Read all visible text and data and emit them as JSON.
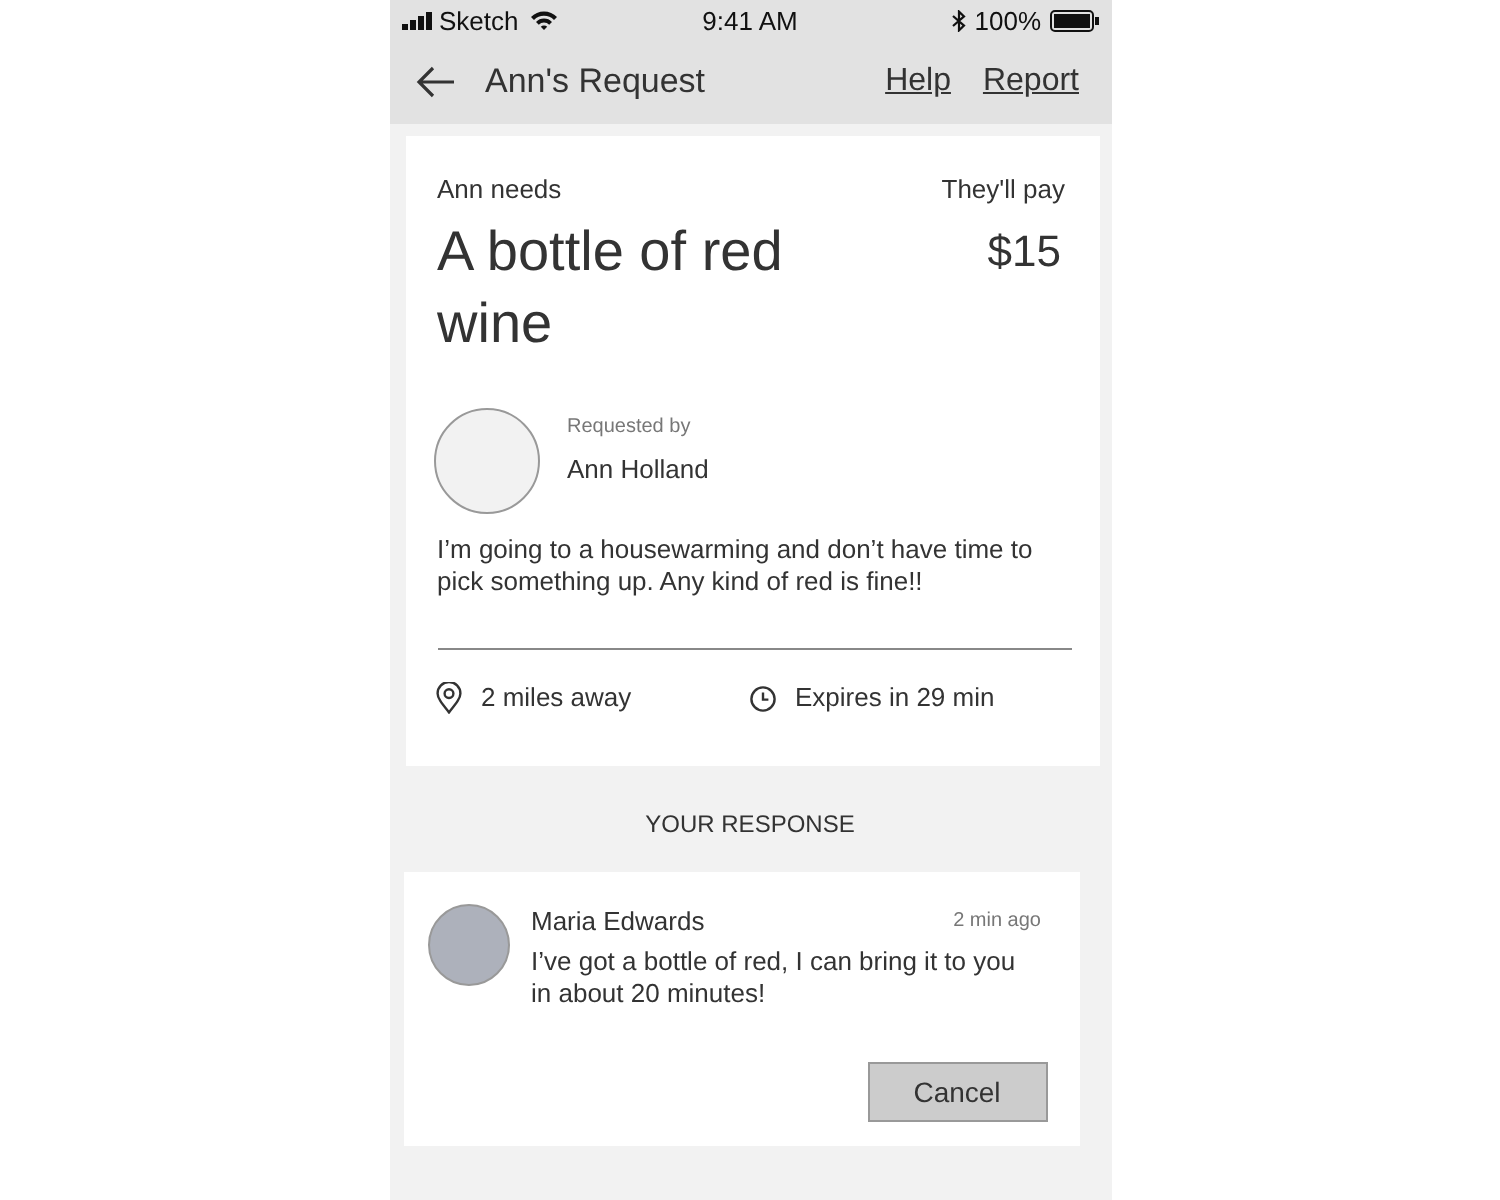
{
  "status_bar": {
    "carrier": "Sketch",
    "time": "9:41 AM",
    "battery": "100%"
  },
  "nav": {
    "title": "Ann's Request",
    "links": [
      "Help",
      "Report"
    ]
  },
  "request": {
    "need_label": "Ann needs",
    "item": "A bottle of red wine",
    "pay_label": "They'll pay",
    "amount": "$15",
    "requester_label": "Requested by",
    "requester": "Ann Holland",
    "message": "I’m going to a housewarming and don’t have time to pick something up. Any kind of red is fine!!",
    "distance": "2 miles away",
    "expiry": "Expires in 29 min"
  },
  "response_heading": "YOUR RESPONSE",
  "response": {
    "name": "Maria Edwards",
    "time": "2 min ago",
    "message": "I’ve got a bottle of red, I can bring it to you in about 20 minutes!",
    "button": "Cancel"
  }
}
